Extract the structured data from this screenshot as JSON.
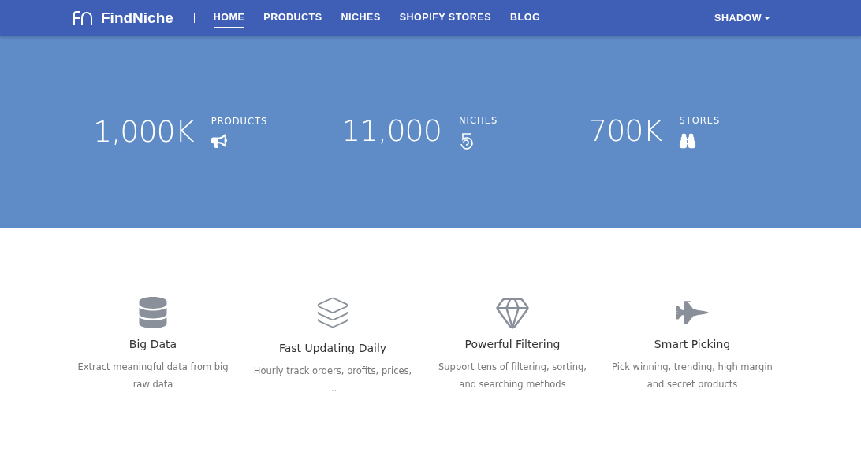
{
  "header": {
    "logo": "FindNiche",
    "nav": [
      {
        "label": "HOME",
        "selected": true
      },
      {
        "label": "PRODUCTS",
        "selected": false
      },
      {
        "label": "NICHES",
        "selected": false
      },
      {
        "label": "SHOPIFY STORES",
        "selected": false
      },
      {
        "label": "BLOG",
        "selected": false
      }
    ],
    "user": "SHADOW"
  },
  "stats": [
    {
      "value": "1,000K",
      "label": "PRODUCTS",
      "kind": "megaphone"
    },
    {
      "value": "11,000",
      "label": "NICHES",
      "kind": "spiral"
    },
    {
      "value": "700K",
      "label": "STORES",
      "kind": "binoculars"
    }
  ],
  "features": [
    {
      "title": "Big Data",
      "description": "Extract meaningful data from big raw data",
      "kind": "database"
    },
    {
      "title": "Fast Updating Daily",
      "description": "Hourly track orders, profits, prices, ...",
      "kind": "layers"
    },
    {
      "title": "Powerful Filtering",
      "description": "Support tens of filtering, sorting, and searching methods",
      "kind": "diamond"
    },
    {
      "title": "Smart Picking",
      "description": "Pick winning, trending, high margin and secret products",
      "kind": "jet"
    }
  ]
}
